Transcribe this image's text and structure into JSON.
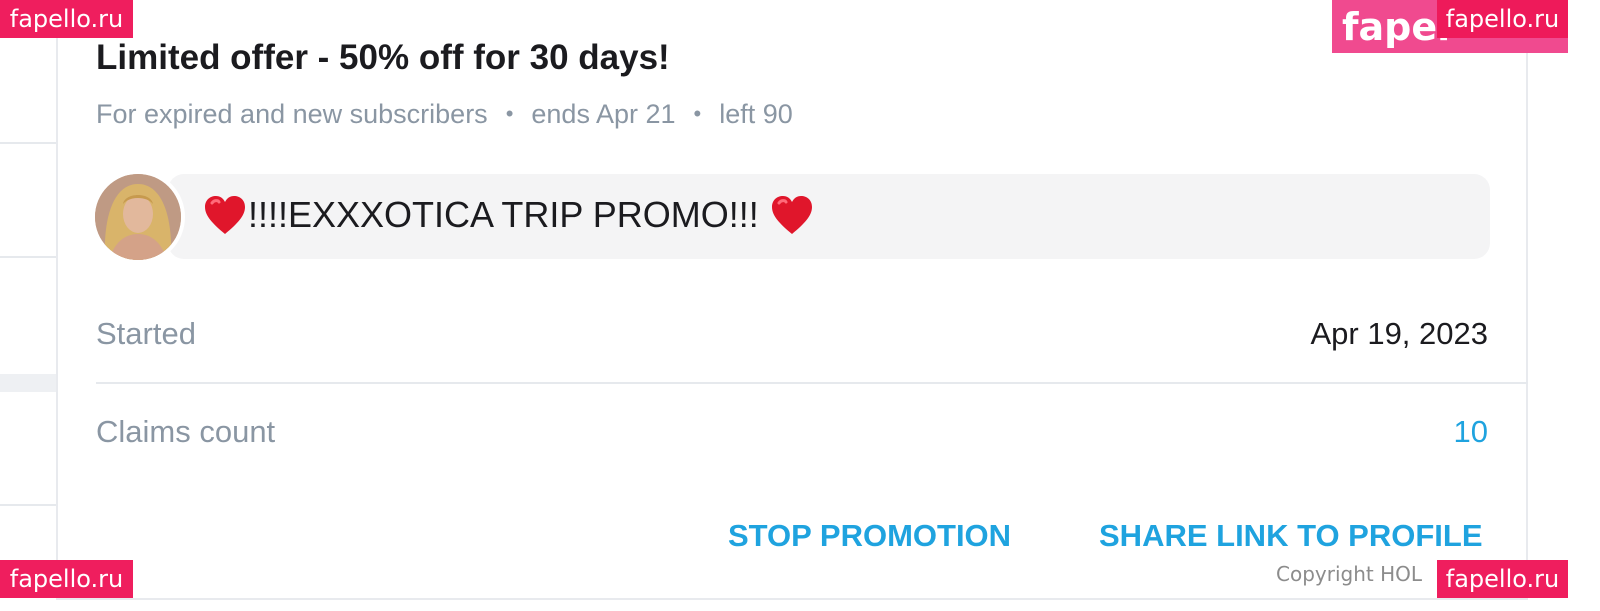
{
  "offer": {
    "title": "Limited offer - 50% off for 30 days!",
    "audience": "For expired and new subscribers",
    "ends": "ends Apr 21",
    "left": "left 90",
    "separator": "•"
  },
  "message": {
    "avatar_icon": "user-avatar",
    "heart_icon": "red-heart-icon",
    "text": "!!!!EXXXOTICA TRIP PROMO!!!"
  },
  "details": {
    "started_label": "Started",
    "started_value": "Apr 19, 2023",
    "claims_label": "Claims count",
    "claims_value": "10"
  },
  "actions": {
    "stop_label": "STOP PROMOTION",
    "share_label": "SHARE LINK TO PROFILE"
  },
  "footer": {
    "copyright": "Copyright HOL"
  },
  "watermarks": {
    "small_text": "fapello.ru",
    "big_text": "fapel"
  },
  "colors": {
    "accent": "#1fa3df",
    "muted_text": "#8a96a3",
    "watermark": "#ef1e5e",
    "heart": "#e0162b"
  }
}
